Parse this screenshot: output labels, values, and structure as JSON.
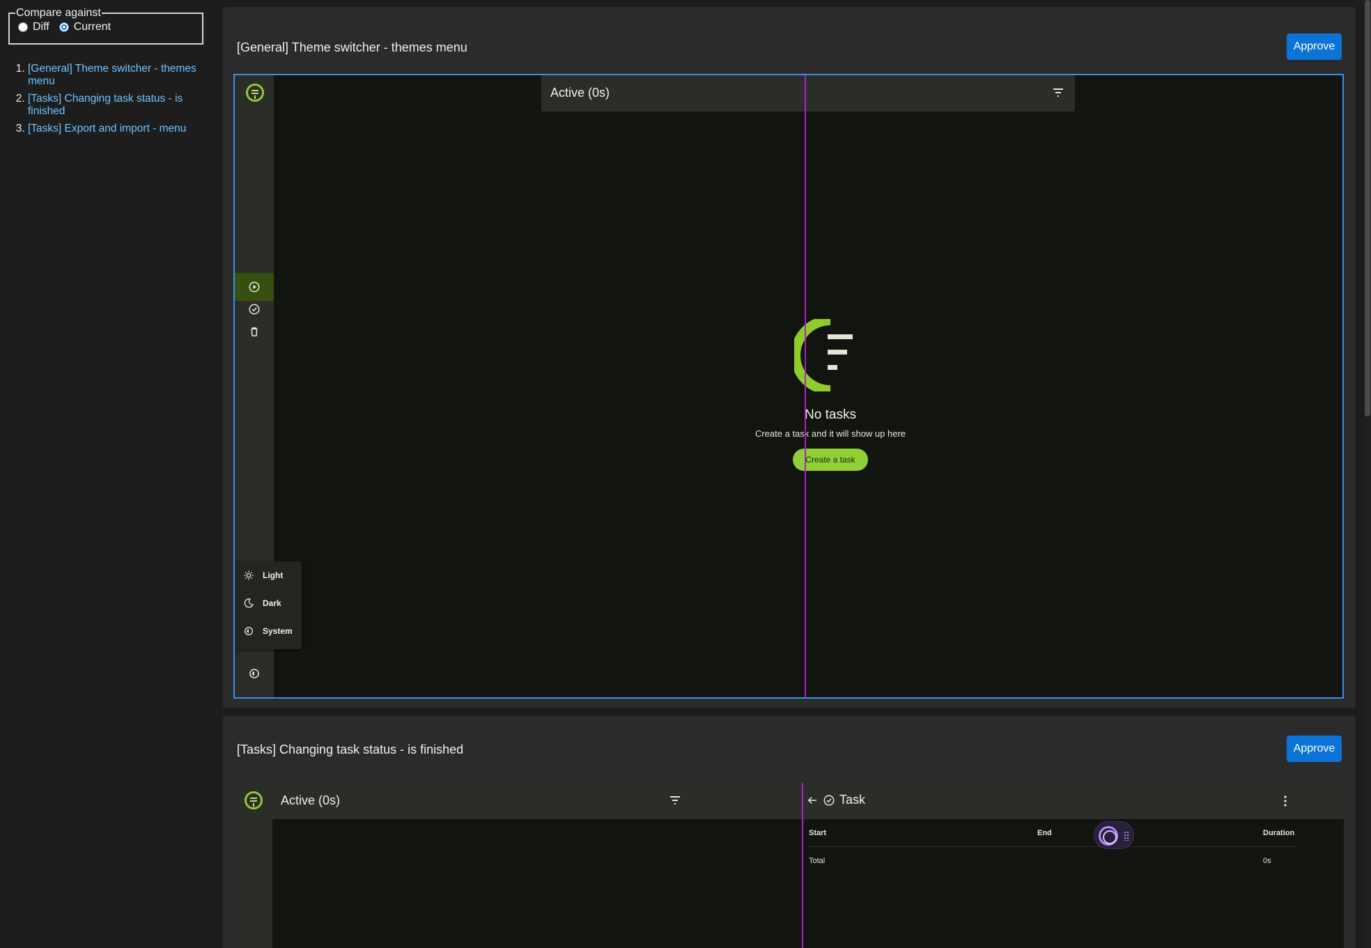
{
  "compare": {
    "legend": "Compare against",
    "options": [
      {
        "label": "Diff",
        "checked": false
      },
      {
        "label": "Current",
        "checked": true
      }
    ]
  },
  "scenarios": [
    "[General] Theme switcher - themes menu",
    "[Tasks] Changing task status - is finished",
    "[Tasks] Export and import - menu"
  ],
  "cards": [
    {
      "title": "[General] Theme switcher - themes menu",
      "approve_label": "Approve"
    },
    {
      "title": "[Tasks] Changing task status - is finished",
      "approve_label": "Approve"
    }
  ],
  "shot1": {
    "header_title": "Active (0s)",
    "empty_title": "No tasks",
    "empty_subtitle": "Create a task and it will show up here",
    "create_button": "Create a task",
    "rail_icons": [
      "logo-icon",
      "play-circle-icon",
      "check-circle-icon",
      "trash-icon",
      "settings-icon"
    ],
    "theme_menu": [
      "Light",
      "Dark",
      "System"
    ]
  },
  "shot2": {
    "header_title": "Active (0s)",
    "task_title": "Task",
    "table_headers": {
      "start": "Start",
      "end": "End",
      "duration": "Duration"
    },
    "total_row": {
      "label": "Total",
      "end": "",
      "duration": "0s"
    }
  },
  "colors": {
    "accent_green": "#8fd036",
    "approve_blue": "#0b74d6",
    "diff_line": "#b01fc7",
    "link": "#6fc4ff"
  }
}
